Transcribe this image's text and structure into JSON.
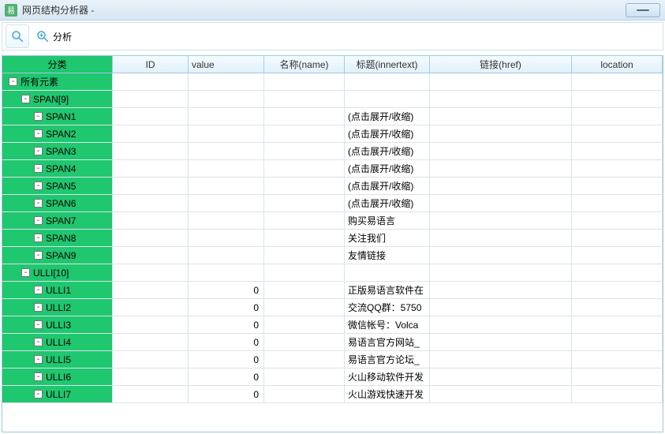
{
  "window": {
    "title": "网页结构分析器 -"
  },
  "toolbar": {
    "analyze_label": "分析"
  },
  "columns": {
    "tree": "分类",
    "id": "ID",
    "value": "value",
    "name": "名称(name)",
    "title": "标题(innertext)",
    "href": "链接(href)",
    "location": "location"
  },
  "tree": [
    {
      "depth": 0,
      "expander": "-",
      "label": "所有元素",
      "value": "",
      "title": ""
    },
    {
      "depth": 1,
      "expander": "-",
      "label": "SPAN[9]",
      "value": "",
      "title": ""
    },
    {
      "depth": 2,
      "expander": "-",
      "label": "SPAN1",
      "value": "",
      "title": "(点击展开/收缩)"
    },
    {
      "depth": 2,
      "expander": "-",
      "label": "SPAN2",
      "value": "",
      "title": "(点击展开/收缩)"
    },
    {
      "depth": 2,
      "expander": "-",
      "label": "SPAN3",
      "value": "",
      "title": "(点击展开/收缩)"
    },
    {
      "depth": 2,
      "expander": "-",
      "label": "SPAN4",
      "value": "",
      "title": "(点击展开/收缩)"
    },
    {
      "depth": 2,
      "expander": "-",
      "label": "SPAN5",
      "value": "",
      "title": "(点击展开/收缩)"
    },
    {
      "depth": 2,
      "expander": "-",
      "label": "SPAN6",
      "value": "",
      "title": "(点击展开/收缩)"
    },
    {
      "depth": 2,
      "expander": "-",
      "label": "SPAN7",
      "value": "",
      "title": "购买易语言"
    },
    {
      "depth": 2,
      "expander": "-",
      "label": "SPAN8",
      "value": "",
      "title": "关注我们"
    },
    {
      "depth": 2,
      "expander": "-",
      "label": "SPAN9",
      "value": "",
      "title": "友情链接"
    },
    {
      "depth": 1,
      "expander": "-",
      "label": "ULLI[10]",
      "value": "",
      "title": ""
    },
    {
      "depth": 2,
      "expander": "-",
      "label": "ULLI1",
      "value": "0",
      "title": "正版易语言软件在"
    },
    {
      "depth": 2,
      "expander": "-",
      "label": "ULLI2",
      "value": "0",
      "title": "交流QQ群：5750"
    },
    {
      "depth": 2,
      "expander": "-",
      "label": "ULLI3",
      "value": "0",
      "title": "微信帐号：Volca"
    },
    {
      "depth": 2,
      "expander": "-",
      "label": "ULLI4",
      "value": "0",
      "title": "易语言官方网站_"
    },
    {
      "depth": 2,
      "expander": "-",
      "label": "ULLI5",
      "value": "0",
      "title": "易语言官方论坛_"
    },
    {
      "depth": 2,
      "expander": "-",
      "label": "ULLI6",
      "value": "0",
      "title": "火山移动软件开发"
    },
    {
      "depth": 2,
      "expander": "-",
      "label": "ULLI7",
      "value": "0",
      "title": "火山游戏快速开发"
    }
  ]
}
